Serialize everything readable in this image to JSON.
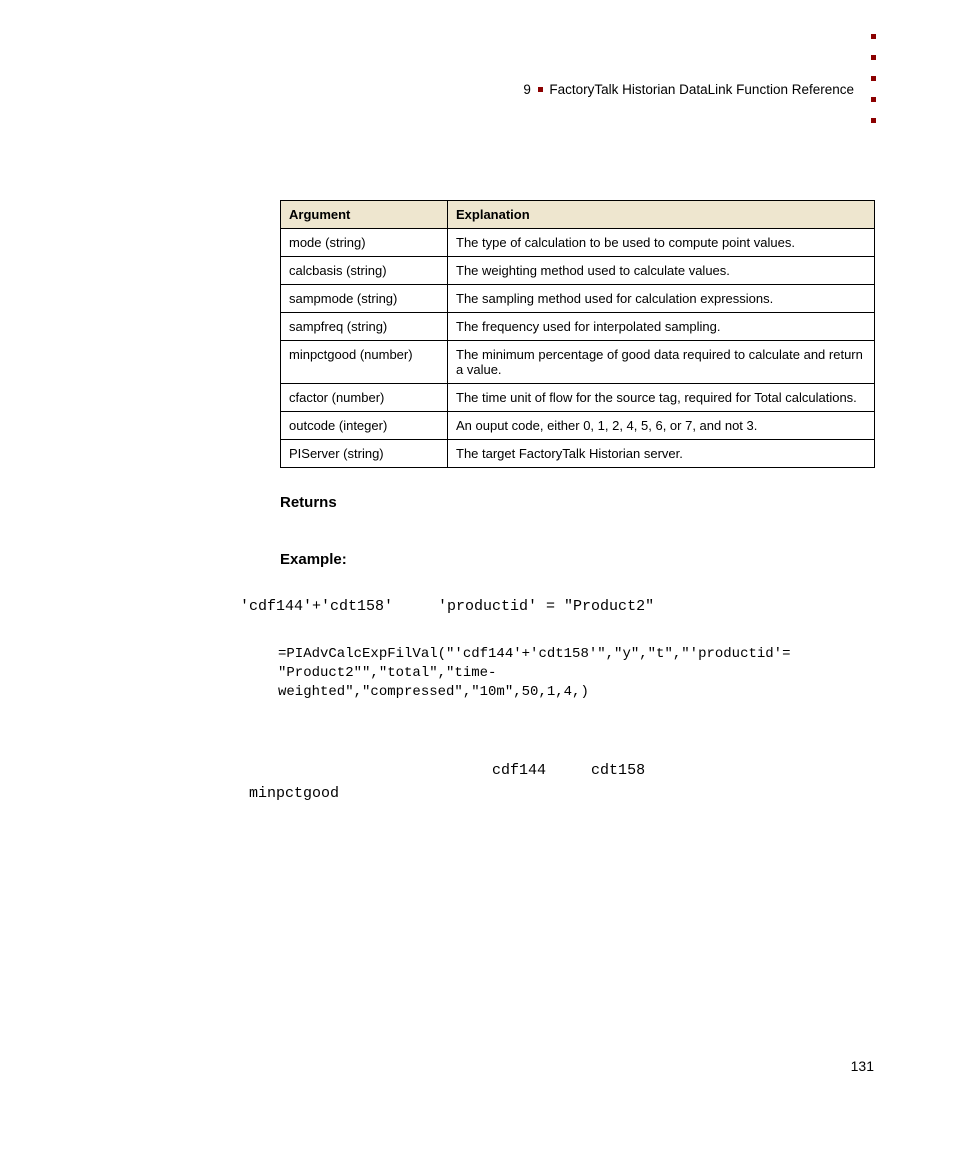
{
  "header": {
    "chapter_number": "9",
    "chapter_title": "FactoryTalk Historian DataLink Function Reference"
  },
  "table": {
    "headers": [
      "Argument",
      "Explanation"
    ],
    "rows": [
      [
        "mode (string)",
        "The type of calculation to be used to compute point values."
      ],
      [
        "calcbasis (string)",
        "The weighting method used to calculate values."
      ],
      [
        "sampmode (string)",
        "The sampling method used for calculation expressions."
      ],
      [
        "sampfreq (string)",
        "The frequency used for interpolated sampling."
      ],
      [
        "minpctgood (number)",
        "The minimum percentage of good data required to calculate and return a value."
      ],
      [
        "cfactor (number)",
        "The time unit of flow for the source tag, required for Total calculations."
      ],
      [
        "outcode (integer)",
        "An ouput code, either 0, 1, 2, 4, 5, 6, or 7, and not 3."
      ],
      [
        "PIServer (string)",
        "The target FactoryTalk Historian server."
      ]
    ]
  },
  "sections": {
    "returns": "Returns",
    "example": "Example:"
  },
  "example": {
    "line1": "'cdf144'+'cdt158'     'productid' = \"Product2\"",
    "code": "=PIAdvCalcExpFilVal(\"'cdf144'+'cdt158'\",\"y\",\"t\",\"'productid'=\n\"Product2\"\",\"total\",\"time-\nweighted\",\"compressed\",\"10m\",50,1,4,)",
    "trail_line1": "                            cdf144     cdt158",
    "trail_line2": " minpctgood"
  },
  "page_number": "131"
}
